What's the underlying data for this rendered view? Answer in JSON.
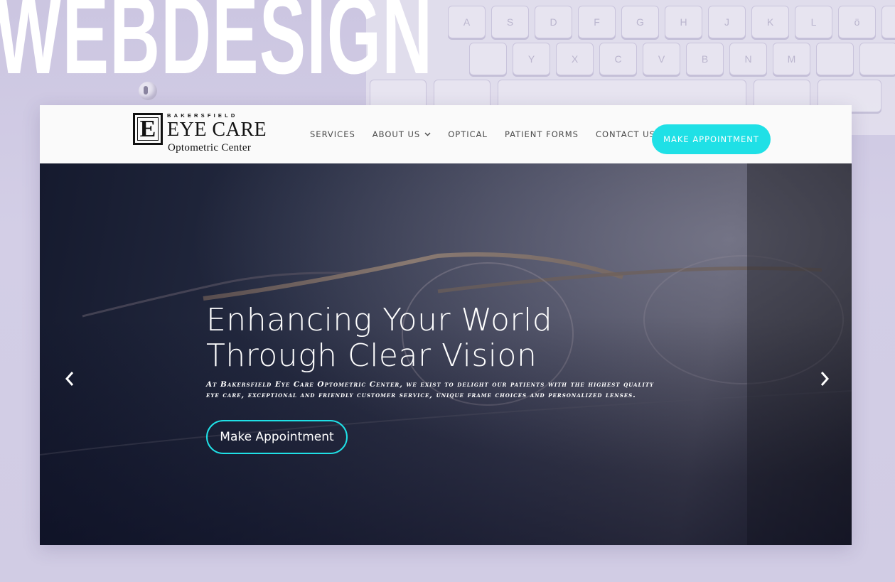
{
  "background": {
    "word": "WEBDESIGN",
    "keyboard_keys_row1": [
      "A",
      "S",
      "D",
      "F",
      "G",
      "H",
      "J",
      "K",
      "L",
      "ö",
      ""
    ],
    "keyboard_keys_row2": [
      "",
      "Y",
      "X",
      "C",
      "V",
      "B",
      "N",
      "M",
      "",
      "",
      ""
    ],
    "colors": {
      "backdrop": "#d2cde6"
    }
  },
  "site": {
    "logo": {
      "mark": "E",
      "top_text": "BAKERSFIELD",
      "main_text": "EYE CARE",
      "sub_text": "Optometric Center"
    },
    "nav": {
      "items": [
        {
          "label": "SERVICES"
        },
        {
          "label": "ABOUT US",
          "has_dropdown": true
        },
        {
          "label": "OPTICAL"
        },
        {
          "label": "PATIENT FORMS"
        },
        {
          "label": "CONTACT US"
        }
      ],
      "cta_label": "MAKE APPOINTMENT"
    },
    "hero": {
      "title": "Enhancing Your World Through Clear Vision",
      "text": "At Bakersfield Eye Care Optometric Center, we exist to delight our patients with the highest quality eye care, exceptional and friendly customer service, unique frame choices and personalized lenses.",
      "button_label": "Make Appointment",
      "icons": {
        "prev": "chevron-left-icon",
        "next": "chevron-right-icon"
      }
    },
    "colors": {
      "accent": "#1fe0e6",
      "header_bg": "#fafafa",
      "nav_text": "#4a4a4a",
      "hero_text": "#ffffff"
    }
  }
}
